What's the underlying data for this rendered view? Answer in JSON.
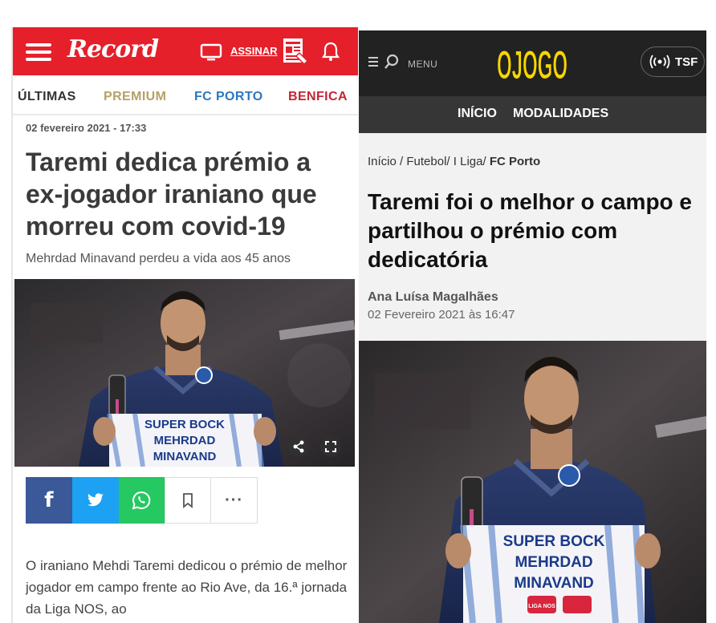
{
  "left": {
    "header": {
      "logo": "Record",
      "subscribe": "ASSINAR",
      "icons": [
        "menu-icon",
        "tv-icon",
        "newspaper-icon",
        "bell-icon"
      ]
    },
    "tabs": [
      "ÚLTIMAS",
      "PREMIUM",
      "FC PORTO",
      "BENFICA"
    ],
    "article": {
      "date": "02 fevereiro 2021 - 17:33",
      "headline": "Taremi dedica prémio a ex-jogador iraniano que morreu com covid-19",
      "subtitle": "Mehrdad Minavand perdeu a vida aos 45 anos",
      "shirt_text": [
        "SUPER BOCK",
        "MEHRDAD",
        "MINAVAND"
      ],
      "body": "O iraniano Mehdi Taremi dedicou o prémio de melhor jogador em campo frente ao Rio Ave, da 16.ª jornada da Liga NOS, ao"
    },
    "social": [
      "facebook-icon",
      "twitter-icon",
      "whatsapp-icon",
      "bookmark-icon",
      "more-icon"
    ],
    "more_label": "···",
    "colors": {
      "brand": "#e5202b",
      "premium": "#b4a267",
      "fcporto": "#2d77c0",
      "benfica": "#c42533"
    }
  },
  "right": {
    "header": {
      "menu_label": "MENU",
      "logo": "OJOGO",
      "radio": "TSF"
    },
    "nav": [
      "INÍCIO",
      "MODALIDADES"
    ],
    "breadcrumb": {
      "items": [
        "Início",
        "Futebol",
        "I Liga"
      ],
      "current": "FC Porto"
    },
    "article": {
      "headline": "Taremi foi o melhor o campo e partilhou o prémio com dedicatória",
      "author": "Ana Luísa Magalhães",
      "date": "02 Fevereiro 2021 às 16:47",
      "shirt_text": [
        "SUPER BOCK",
        "MEHRDAD",
        "MINAVAND"
      ],
      "sponsor": "LIGA NOS"
    },
    "colors": {
      "logo": "#f6d600",
      "header": "#222222",
      "nav": "#363636"
    }
  }
}
